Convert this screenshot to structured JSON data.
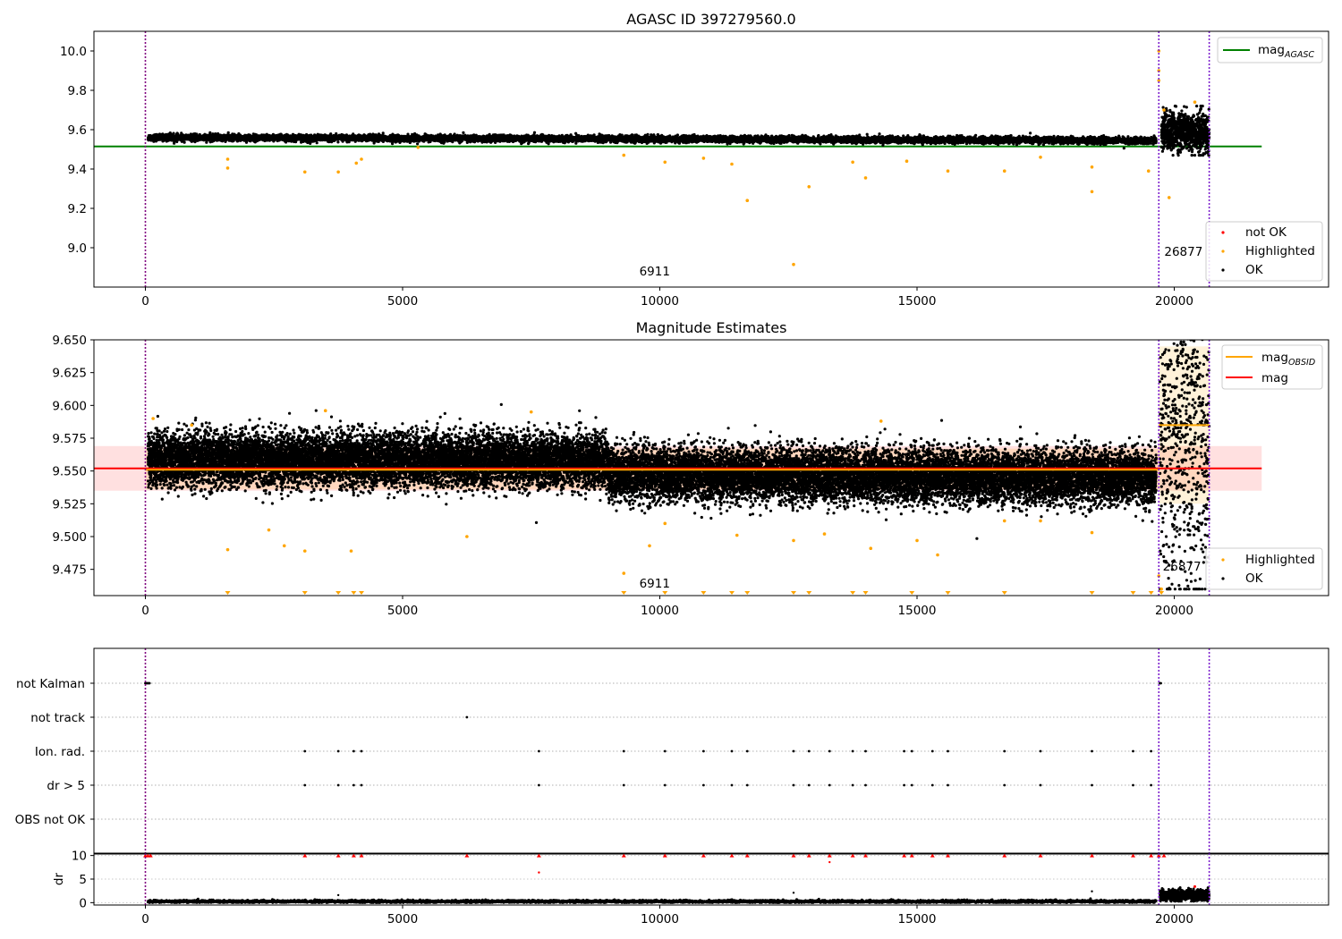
{
  "figure": {
    "title_top": "AGASC ID 397279560.0",
    "title_middle": "Magnitude Estimates"
  },
  "chart_data": [
    {
      "type": "scatter",
      "title": "AGASC ID 397279560.0",
      "xlabel": "",
      "ylabel": "",
      "xlim": [
        -1000,
        23000
      ],
      "ylim": [
        8.8,
        10.1
      ],
      "xticks": [
        0,
        5000,
        10000,
        15000,
        20000
      ],
      "yticks": [
        9.0,
        9.2,
        9.4,
        9.6,
        9.8,
        10.0
      ],
      "ytick_labels": [
        "9.0",
        "9.2",
        "9.4",
        "9.6",
        "9.8",
        "10.0"
      ],
      "lines": [
        {
          "name": "mag_AGASC",
          "label_main": "mag",
          "label_sub": "AGASC",
          "y": 9.515,
          "x": [
            -1000,
            21700
          ],
          "color": "#008000"
        }
      ],
      "vlines": [
        {
          "x": 0,
          "color": "#800080"
        },
        {
          "x": 19700,
          "color": "#7e22ce"
        },
        {
          "x": 20680,
          "color": "#7e22ce"
        }
      ],
      "annotations": [
        {
          "text": "6911",
          "x": 9900,
          "y": 8.86
        },
        {
          "text": "26877",
          "x": 20180,
          "y": 8.96
        }
      ],
      "series": [
        {
          "name": "not OK",
          "color": "#ff0000",
          "values": []
        },
        {
          "name": "Highlighted",
          "color": "#ffa500",
          "points": [
            [
              1600,
              9.405
            ],
            [
              1600,
              9.45
            ],
            [
              3100,
              9.385
            ],
            [
              3750,
              9.385
            ],
            [
              4100,
              9.43
            ],
            [
              4200,
              9.45
            ],
            [
              5300,
              9.51
            ],
            [
              9300,
              9.47
            ],
            [
              10100,
              9.435
            ],
            [
              10850,
              9.455
            ],
            [
              11400,
              9.425
            ],
            [
              11700,
              9.24
            ],
            [
              12600,
              8.915
            ],
            [
              12900,
              9.31
            ],
            [
              13750,
              9.435
            ],
            [
              14000,
              9.355
            ],
            [
              14800,
              9.44
            ],
            [
              15600,
              9.39
            ],
            [
              16700,
              9.39
            ],
            [
              17400,
              9.46
            ],
            [
              18400,
              9.285
            ],
            [
              18400,
              9.41
            ],
            [
              19700,
              10.0
            ],
            [
              19700,
              9.9
            ],
            [
              19700,
              9.85
            ],
            [
              19800,
              9.7
            ],
            [
              19900,
              9.255
            ],
            [
              20400,
              9.74
            ],
            [
              19500,
              9.39
            ]
          ]
        },
        {
          "name": "OK",
          "color": "#000000",
          "band": {
            "x": [
              50,
              19650
            ],
            "center_start": 9.56,
            "center_end": 9.545,
            "spread": 0.015
          }
        }
      ],
      "legend": {
        "position": "lower-right",
        "entries": [
          "not OK",
          "Highlighted",
          "OK"
        ]
      }
    },
    {
      "type": "scatter",
      "title": "Magnitude Estimates",
      "xlabel": "",
      "ylabel": "",
      "xlim": [
        -1000,
        23000
      ],
      "ylim": [
        9.455,
        9.65
      ],
      "xticks": [
        0,
        5000,
        10000,
        15000,
        20000
      ],
      "yticks": [
        9.475,
        9.5,
        9.525,
        9.55,
        9.575,
        9.6,
        9.625,
        9.65
      ],
      "ytick_labels": [
        "9.475",
        "9.500",
        "9.525",
        "9.550",
        "9.575",
        "9.600",
        "9.625",
        "9.650"
      ],
      "lines": [
        {
          "name": "mag_OBSID",
          "label_main": "mag",
          "label_sub": "OBSID",
          "segments": [
            {
              "x": [
                0,
                19700
              ],
              "y": 9.551
            },
            {
              "x": [
                19700,
                20680
              ],
              "y": 9.585
            }
          ],
          "color": "#ffa500"
        },
        {
          "name": "mag",
          "label_main": "mag",
          "y": 9.552,
          "x": [
            -1000,
            21700
          ],
          "color": "#ff0000",
          "band": [
            9.535,
            9.569
          ]
        }
      ],
      "vlines": [
        {
          "x": 0,
          "color": "#800080"
        },
        {
          "x": 19700,
          "color": "#7e22ce"
        },
        {
          "x": 20680,
          "color": "#7e22ce"
        }
      ],
      "annotations": [
        {
          "text": "6911",
          "x": 9900,
          "y": 9.461
        },
        {
          "text": "26877",
          "x": 20150,
          "y": 9.474
        }
      ],
      "series": [
        {
          "name": "Highlighted",
          "color": "#ffa500",
          "points": [
            [
              150,
              9.59
            ],
            [
              900,
              9.585
            ],
            [
              1600,
              9.49
            ],
            [
              2400,
              9.505
            ],
            [
              2700,
              9.493
            ],
            [
              3100,
              9.489
            ],
            [
              3500,
              9.596
            ],
            [
              4000,
              9.489
            ],
            [
              6250,
              9.5
            ],
            [
              7500,
              9.595
            ],
            [
              9300,
              9.472
            ],
            [
              9800,
              9.493
            ],
            [
              10100,
              9.51
            ],
            [
              11500,
              9.501
            ],
            [
              12600,
              9.497
            ],
            [
              13200,
              9.502
            ],
            [
              14100,
              9.491
            ],
            [
              14300,
              9.588
            ],
            [
              15000,
              9.497
            ],
            [
              15400,
              9.486
            ],
            [
              16700,
              9.512
            ],
            [
              17400,
              9.512
            ],
            [
              18400,
              9.503
            ],
            [
              19700,
              9.47
            ],
            [
              19750,
              9.46
            ]
          ]
        },
        {
          "name": "OK",
          "color": "#000000",
          "band": {
            "x": [
              50,
              20680
            ],
            "center_start": 9.558,
            "center_end": 9.545,
            "spread": 0.016
          }
        }
      ],
      "legend": {
        "position": "lower-right",
        "entries": [
          "Highlighted",
          "OK"
        ]
      },
      "legend_upper": {
        "position": "top-right",
        "entries": [
          "mag_OBSID",
          "mag"
        ]
      }
    },
    {
      "type": "scatter",
      "title": "",
      "xlabel": "",
      "ylabel": "",
      "categories": [
        "not Kalman",
        "not track",
        "Ion. rad.",
        "dr > 5",
        "OBS not OK"
      ],
      "xlim": [
        -1000,
        23000
      ],
      "flag_times": {
        "not Kalman": [
          0,
          20,
          40,
          60,
          80,
          19720,
          19740
        ],
        "not track": [
          6250
        ],
        "Ion. rad.": [
          3100,
          3750,
          4050,
          4200,
          7650,
          9300,
          10100,
          10850,
          11400,
          11700,
          12600,
          12900,
          13300,
          13750,
          14000,
          14750,
          14900,
          15300,
          15600,
          16700,
          17400,
          18400,
          19200,
          19550
        ],
        "dr > 5": [
          3100,
          3750,
          4050,
          4200,
          7650,
          9300,
          10100,
          10850,
          11400,
          11700,
          12600,
          12900,
          13300,
          13750,
          14000,
          14750,
          14900,
          15300,
          15600,
          16700,
          17400,
          18400,
          19200,
          19550
        ],
        "OBS not OK": []
      },
      "vlines": [
        {
          "x": 0,
          "color": "#800080"
        },
        {
          "x": 19700,
          "color": "#7e22ce"
        },
        {
          "x": 20680,
          "color": "#7e22ce"
        }
      ]
    },
    {
      "type": "scatter",
      "title": "",
      "xlabel": "",
      "ylabel": "dr",
      "xlim": [
        -1000,
        23000
      ],
      "ylim": [
        -0.5,
        10.5
      ],
      "xticks": [
        0,
        5000,
        10000,
        15000,
        20000
      ],
      "yticks": [
        0,
        5,
        10
      ],
      "ytick_labels": [
        "0",
        "5",
        "10"
      ],
      "series": [
        {
          "name": "red markers at 10",
          "color": "#ff0000",
          "x": [
            0,
            50,
            100,
            3100,
            3750,
            4050,
            4200,
            6250,
            7650,
            9300,
            10100,
            10850,
            11400,
            11700,
            12600,
            12900,
            13300,
            13750,
            14000,
            14750,
            14900,
            15300,
            15600,
            16700,
            17400,
            18400,
            19200,
            19550,
            19700,
            19800
          ],
          "y": 10
        },
        {
          "name": "extra red",
          "color": "#ff0000",
          "points": [
            [
              7650,
              6.4
            ],
            [
              13300,
              8.6
            ]
          ]
        },
        {
          "name": "OK",
          "color": "#000000",
          "band": {
            "x": [
              50,
              19650
            ],
            "center_start": 0.25,
            "center_end": 0.25,
            "spread": 0.25
          }
        }
      ],
      "vlines": [
        {
          "x": 0,
          "color": "#800080"
        },
        {
          "x": 19700,
          "color": "#7e22ce"
        },
        {
          "x": 20680,
          "color": "#7e22ce"
        }
      ]
    }
  ]
}
